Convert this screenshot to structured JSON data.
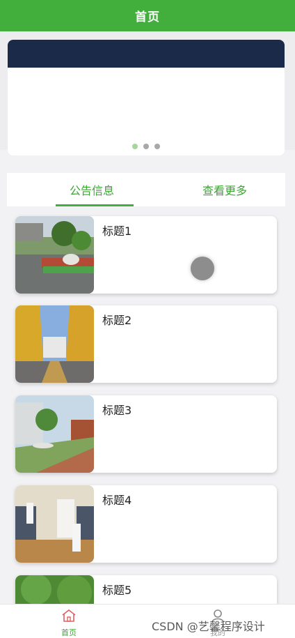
{
  "header": {
    "title": "首页"
  },
  "banner": {
    "dots_count": 3,
    "active_dot": 0
  },
  "tabs": {
    "notice_label": "公告信息",
    "more_label": "查看更多"
  },
  "list": {
    "items": [
      {
        "title": "标题1"
      },
      {
        "title": "标题2"
      },
      {
        "title": "标题3"
      },
      {
        "title": "标题4"
      },
      {
        "title": "标题5"
      }
    ]
  },
  "tabbar": {
    "home_label": "首页",
    "mine_label": "我的"
  },
  "watermark": "CSDN @艺馨程序设计",
  "colors": {
    "primary": "#42ae3b",
    "accent_text": "#3aa632",
    "dot_active": "#a6d79a",
    "dot_inactive": "#a8a8a8"
  }
}
